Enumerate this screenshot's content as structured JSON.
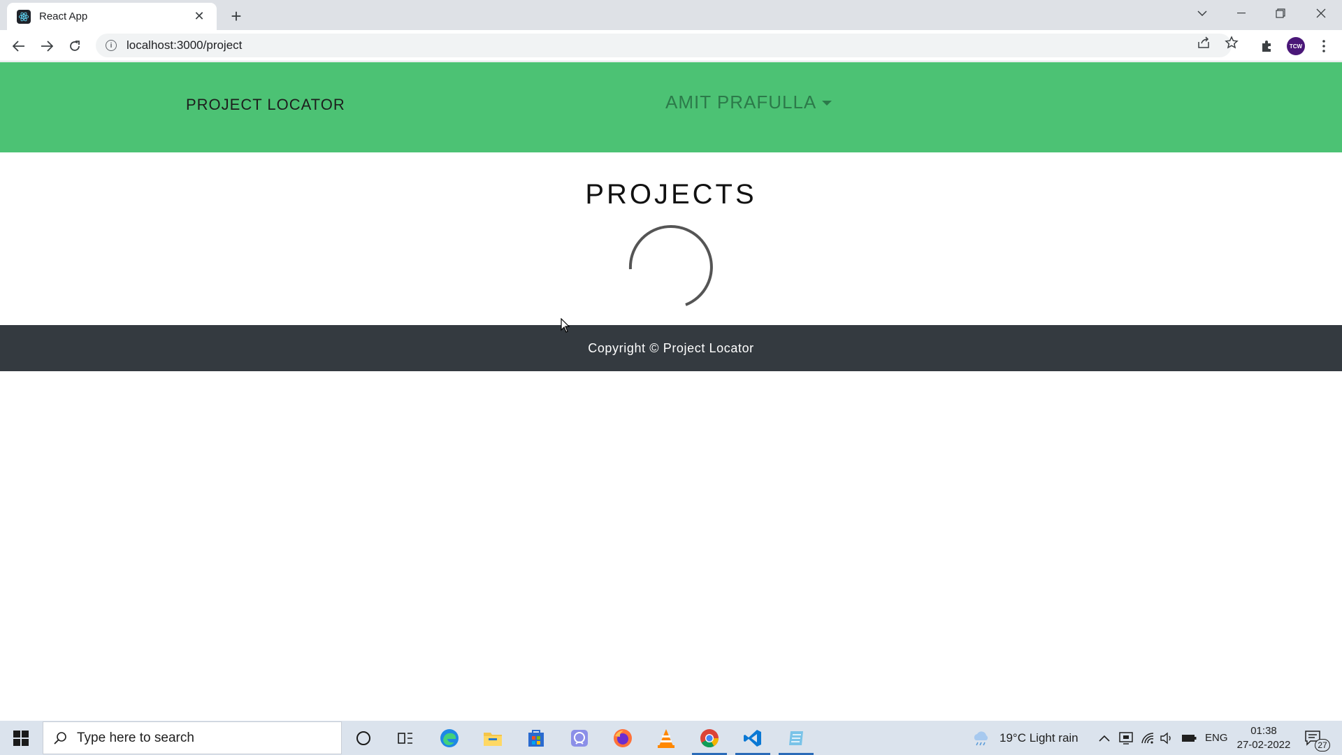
{
  "browser": {
    "tab_title": "React App",
    "url": "localhost:3000/project",
    "profile_initials": "TCW"
  },
  "navbar": {
    "brand": "PROJECT LOCATOR",
    "user_name": "AMIT PRAFULLA",
    "background_color": "#4cc274"
  },
  "main": {
    "title": "PROJECTS",
    "loading_spinner": "spinner-icon"
  },
  "footer": {
    "text": "Copyright © Project Locator",
    "background_color": "#343a40"
  },
  "taskbar": {
    "search_placeholder": "Type here to search",
    "weather": "19°C  Light rain",
    "language": "ENG",
    "time": "01:38",
    "date": "27-02-2022",
    "notification_count": "27"
  }
}
